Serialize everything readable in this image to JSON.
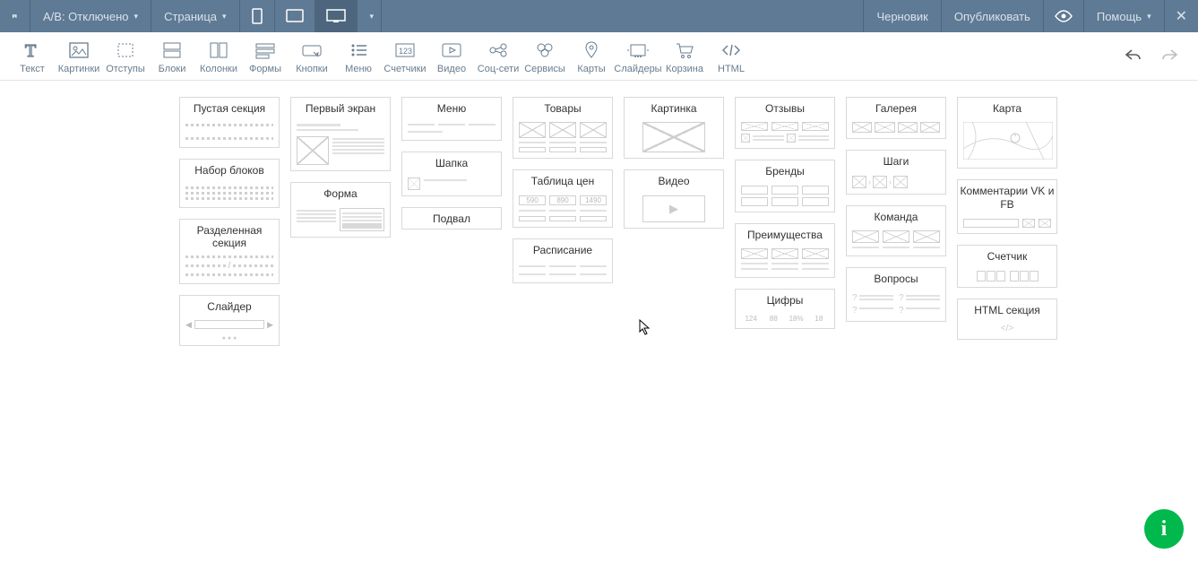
{
  "topbar": {
    "ab_label": "A/B: Отключено",
    "page_label": "Страница",
    "status": "Черновик",
    "publish": "Опубликовать",
    "help": "Помощь"
  },
  "toolbar": {
    "items": [
      {
        "label": "Текст"
      },
      {
        "label": "Картинки"
      },
      {
        "label": "Отступы"
      },
      {
        "label": "Блоки"
      },
      {
        "label": "Колонки"
      },
      {
        "label": "Формы"
      },
      {
        "label": "Кнопки"
      },
      {
        "label": "Меню"
      },
      {
        "label": "Счетчики"
      },
      {
        "label": "Видео"
      },
      {
        "label": "Соц-сети"
      },
      {
        "label": "Сервисы"
      },
      {
        "label": "Карты"
      },
      {
        "label": "Слайдеры"
      },
      {
        "label": "Корзина"
      },
      {
        "label": "HTML"
      }
    ]
  },
  "blocks": {
    "col1": [
      {
        "title": "Пустая секция"
      },
      {
        "title": "Набор блоков"
      },
      {
        "title": "Разделенная секция"
      },
      {
        "title": "Слайдер"
      }
    ],
    "col2": [
      {
        "title": "Первый экран"
      },
      {
        "title": "Форма"
      }
    ],
    "col3": [
      {
        "title": "Меню"
      },
      {
        "title": "Шапка"
      },
      {
        "title": "Подвал"
      }
    ],
    "col4": [
      {
        "title": "Товары"
      },
      {
        "title": "Таблица цен"
      },
      {
        "title": "Расписание"
      }
    ],
    "col5": [
      {
        "title": "Картинка"
      },
      {
        "title": "Видео"
      }
    ],
    "col6": [
      {
        "title": "Отзывы"
      },
      {
        "title": "Бренды"
      },
      {
        "title": "Преимущества"
      },
      {
        "title": "Цифры"
      }
    ],
    "col7": [
      {
        "title": "Галерея"
      },
      {
        "title": "Шаги"
      },
      {
        "title": "Команда"
      },
      {
        "title": "Вопросы"
      }
    ],
    "col8": [
      {
        "title": "Карта"
      },
      {
        "title": "Комментарии VK и FB"
      },
      {
        "title": "Счетчик"
      },
      {
        "title": "HTML секция"
      }
    ]
  },
  "pricing": {
    "a": "590",
    "b": "890",
    "c": "1490"
  },
  "digits": {
    "a": "124",
    "b": "88",
    "c": "18%",
    "d": "18"
  }
}
